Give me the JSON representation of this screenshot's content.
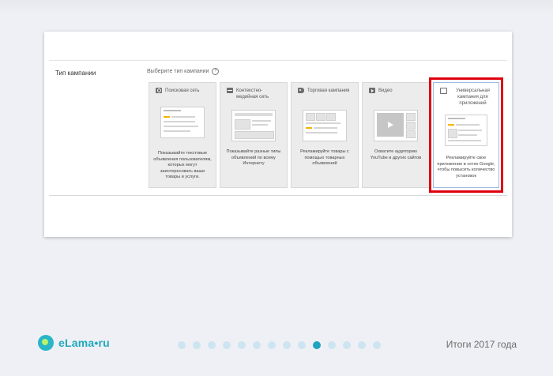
{
  "form": {
    "row_label": "Тип кампании",
    "prompt": "Выберите тип кампании",
    "help_icon": "question-circle-icon"
  },
  "cards": [
    {
      "title": "Поисковая сеть",
      "icon": "search-icon",
      "description": "Показывайте текстовые объявления пользователям, которых могут заинтересовать ваши товары и услуги."
    },
    {
      "title": "Контекстно-медийная сеть",
      "icon": "display-icon",
      "description": "Показывайте разные типы объявлений по всему Интернету"
    },
    {
      "title": "Торговая кампания",
      "icon": "tag-icon",
      "description": "Рекламируйте товары с помощью товарных объявлений"
    },
    {
      "title": "Видео",
      "icon": "video-icon",
      "description": "Охватите аудиторию YouTube и других сайтов"
    },
    {
      "title": "Универсальная кампания для приложений",
      "icon": "app-icon",
      "description": "Рекламируйте свое приложение в сетях Google, чтобы повысить количество установок",
      "selected": true
    }
  ],
  "footer": {
    "brand": "eLama•ru",
    "title": "Итоги 2017 года",
    "slide_count": 14,
    "active_slide": 10
  },
  "colors": {
    "highlight": "#e0000f",
    "brand": "#20a9bd",
    "dot": "#cde5f0",
    "dot_active": "#1fa3c0",
    "accent": "#f4b400"
  }
}
